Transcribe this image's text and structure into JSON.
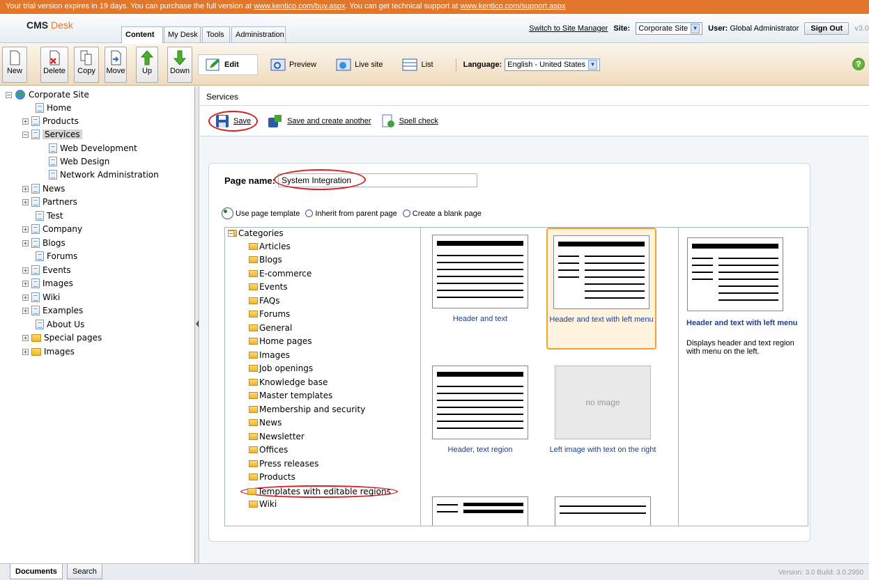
{
  "trial": {
    "text1": "Your trial version expires in 19 days. You can purchase the full version at ",
    "link1": "www.kentico.com/buy.aspx",
    "text2": ". You can get technical support at ",
    "link2": "www.kentico.com/support.aspx"
  },
  "header": {
    "logo_main": "CMS",
    "logo_sub": "Desk",
    "tabs": [
      "Content",
      "My Desk",
      "Tools",
      "Administration"
    ],
    "switch_link": "Switch to Site Manager",
    "site_label": "Site:",
    "site_value": "Corporate Site",
    "user_label": "User:",
    "user_value": "Global Administrator",
    "signout": "Sign Out",
    "version_short": "v3.0"
  },
  "toolbar": {
    "buttons": [
      "New",
      "Delete",
      "Copy",
      "Move",
      "Up",
      "Down"
    ],
    "modes": [
      "Edit",
      "Preview",
      "Live site",
      "List"
    ],
    "language_label": "Language:",
    "language_value": "English - United States",
    "help": "?"
  },
  "tree": {
    "items": [
      {
        "label": "Corporate Site",
        "type": "root"
      },
      {
        "label": "Home",
        "type": "doc"
      },
      {
        "label": "Products",
        "type": "doc",
        "expand": "+"
      },
      {
        "label": "Services",
        "type": "doc",
        "expand": "-",
        "selected": true
      },
      {
        "label": "Web Development",
        "type": "doc"
      },
      {
        "label": "Web Design",
        "type": "doc"
      },
      {
        "label": "Network Administration",
        "type": "doc"
      },
      {
        "label": "News",
        "type": "doc",
        "expand": "+"
      },
      {
        "label": "Partners",
        "type": "doc",
        "expand": "+"
      },
      {
        "label": "Test",
        "type": "doc"
      },
      {
        "label": "Company",
        "type": "doc",
        "expand": "+"
      },
      {
        "label": "Blogs",
        "type": "doc",
        "expand": "+"
      },
      {
        "label": "Forums",
        "type": "doc"
      },
      {
        "label": "Events",
        "type": "doc",
        "expand": "+"
      },
      {
        "label": "Images",
        "type": "doc",
        "expand": "+"
      },
      {
        "label": "Wiki",
        "type": "doc",
        "expand": "+"
      },
      {
        "label": "Examples",
        "type": "doc",
        "expand": "+"
      },
      {
        "label": "About Us",
        "type": "doc"
      },
      {
        "label": "Special pages",
        "type": "folder",
        "expand": "+"
      },
      {
        "label": "Images",
        "type": "folder",
        "expand": "+"
      }
    ]
  },
  "main": {
    "breadcrumb": "Services",
    "actions": [
      "Save",
      "Save and create another",
      "Spell check"
    ],
    "page_name_label": "Page name:",
    "page_name_value": "System Integration",
    "radios": [
      "Use page template",
      "Inherit from parent page",
      "Create a blank page"
    ],
    "categories_root": "Categories",
    "categories": [
      "Articles",
      "Blogs",
      "E-commerce",
      "Events",
      "FAQs",
      "Forums",
      "General",
      "Home pages",
      "Images",
      "Job openings",
      "Knowledge base",
      "Master templates",
      "Membership and security",
      "News",
      "Newsletter",
      "Offices",
      "Press releases",
      "Products",
      "Templates with editable regions",
      "Wiki"
    ],
    "templates": [
      "Header and text",
      "Header and text with left menu",
      "Header, text region",
      "Left image with text on the right"
    ],
    "no_image": "no image",
    "preview_title": "Header and text with left menu",
    "preview_desc": "Displays header and text region with menu on the left."
  },
  "bottom": {
    "tabs": [
      "Documents",
      "Search"
    ],
    "version": "Version: 3.0 Build: 3.0.2950"
  }
}
